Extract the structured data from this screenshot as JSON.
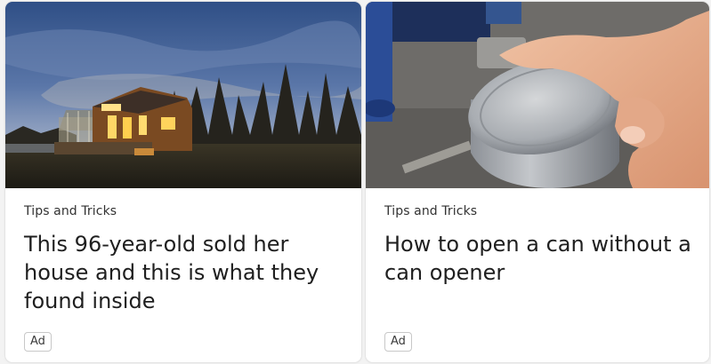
{
  "cards": [
    {
      "category": "Tips and Tricks",
      "title": "This 96-year-old sold her house and this is what they found inside",
      "badge": "Ad",
      "image": "tiny-house-at-dusk"
    },
    {
      "category": "Tips and Tricks",
      "title": "How to open a can without a can opener",
      "badge": "Ad",
      "image": "hand-holding-tin-can"
    }
  ],
  "colors": {
    "card_background": "#ffffff",
    "page_background": "#f3f3f3",
    "title_text": "#1f1f1f",
    "category_text": "#323232"
  }
}
